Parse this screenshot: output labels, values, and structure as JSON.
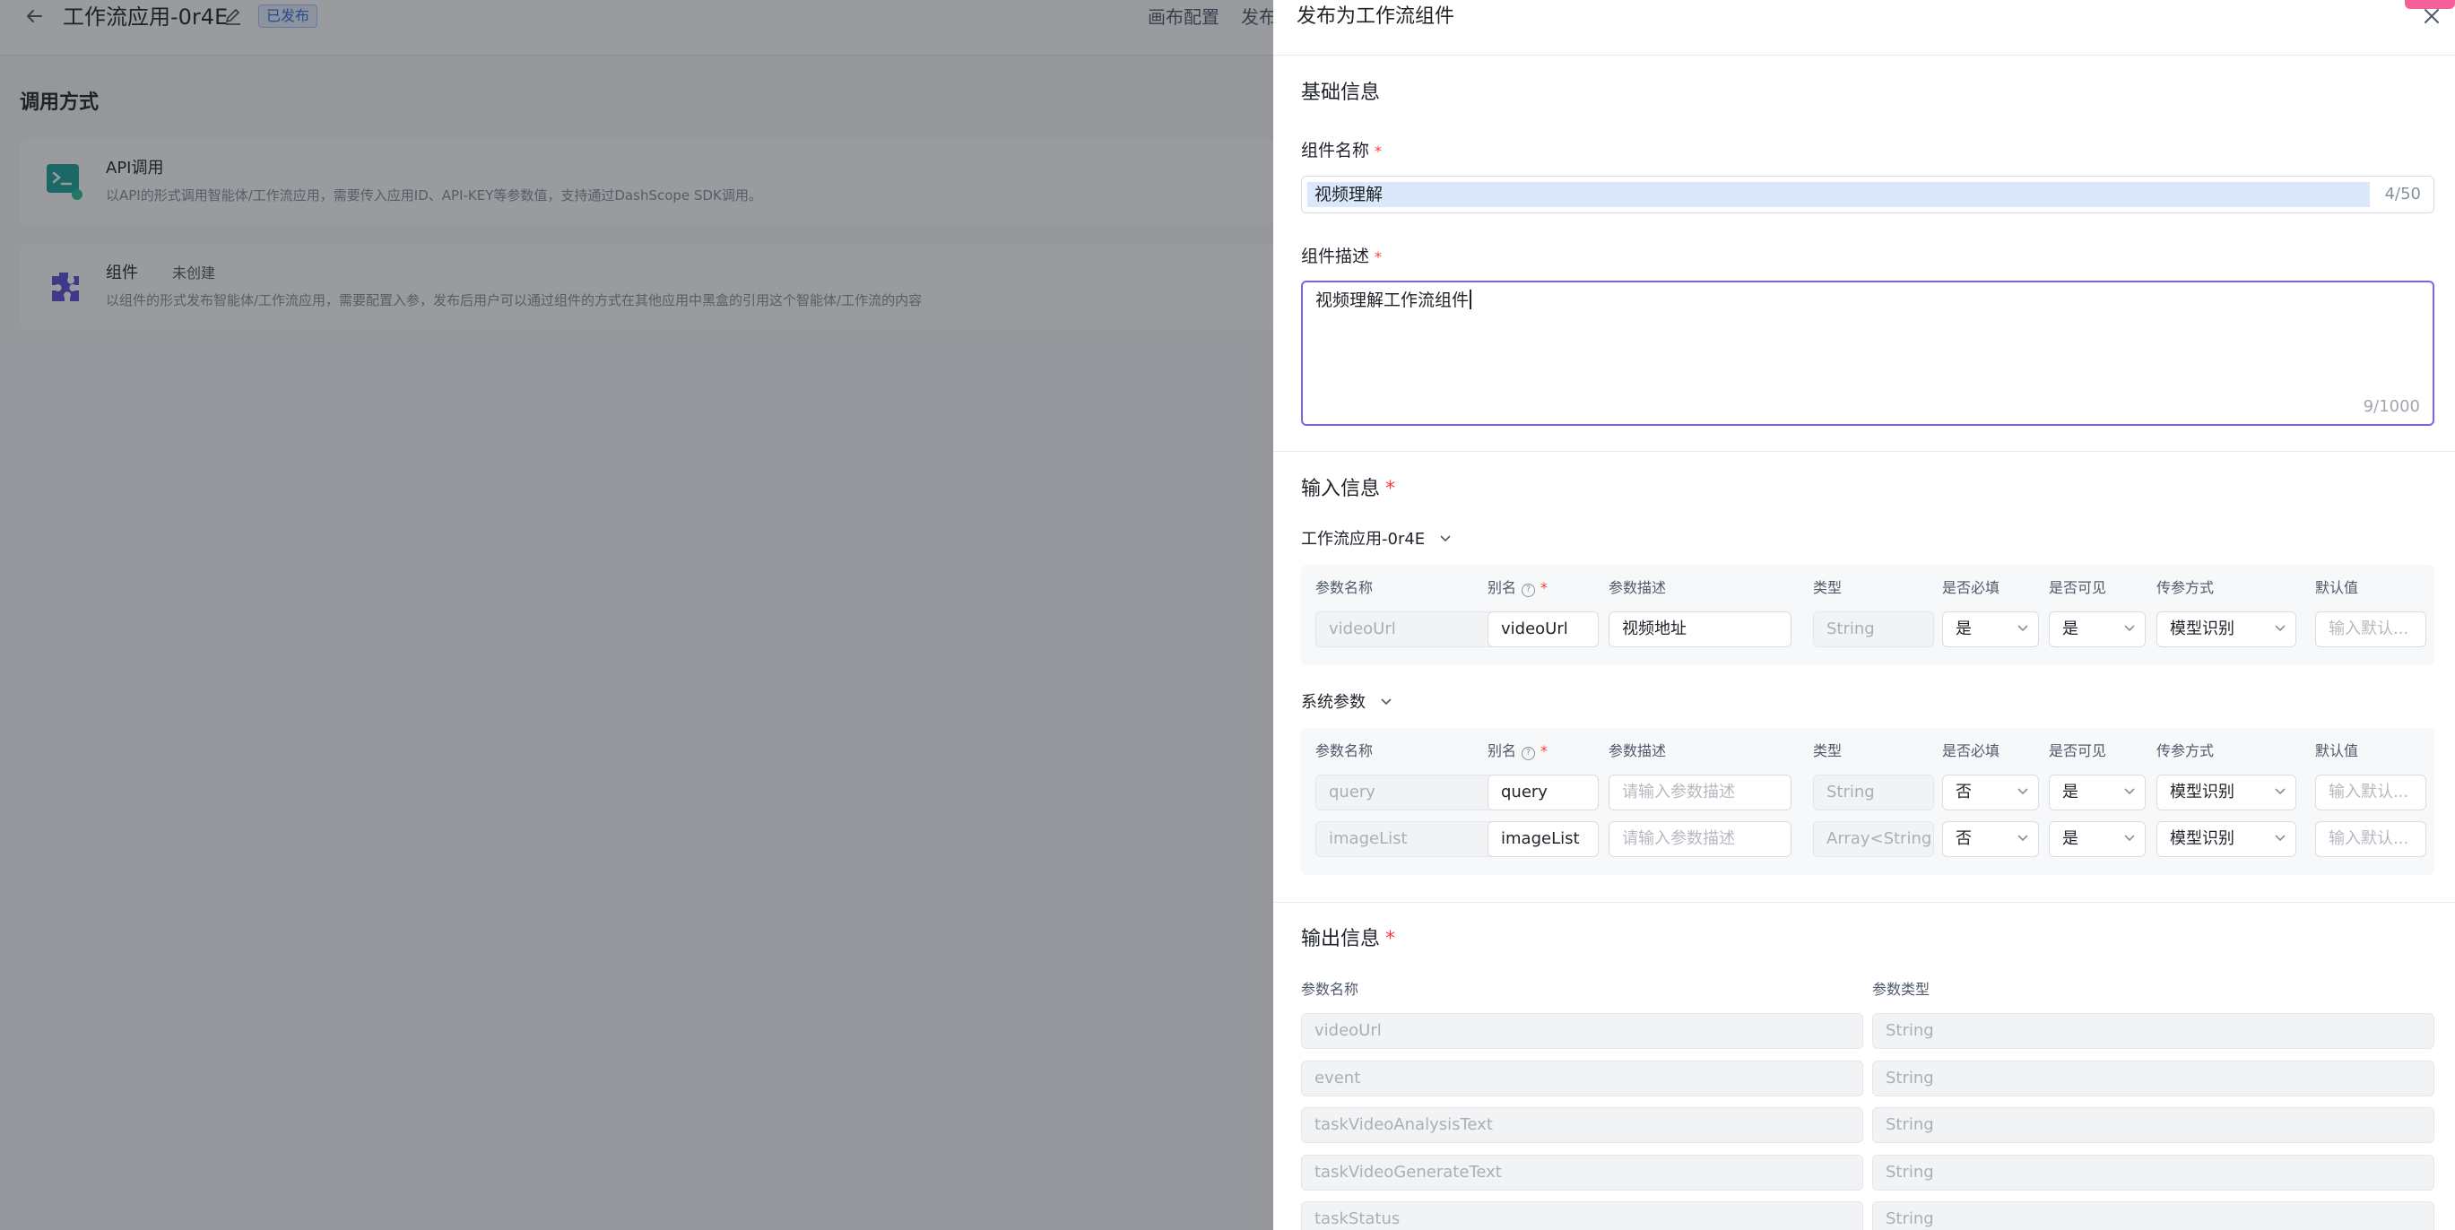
{
  "background": {
    "app_title": "工作流应用-0r4E",
    "status_tag": "已发布",
    "tabs": [
      "画布配置",
      "发布"
    ],
    "section_title": "调用方式",
    "methods": [
      {
        "title": "API调用",
        "subtitle": "",
        "desc": "以API的形式调用智能体/工作流应用，需要传入应用ID、API-KEY等参数值，支持通过DashScope SDK调用。",
        "icon": "terminal-icon"
      },
      {
        "title": "组件",
        "subtitle": "未创建",
        "desc": "以组件的形式发布智能体/工作流应用，需要配置入参，发布后用户可以通过组件的方式在其他应用中黑盒的引用这个智能体/工作流的内容",
        "icon": "puzzle-icon"
      }
    ]
  },
  "drawer": {
    "title": "发布为工作流组件",
    "basic": {
      "title": "基础信息",
      "name_label": "组件名称",
      "name_value": "视频理解",
      "name_count": "4/50",
      "desc_label": "组件描述",
      "desc_value": "视频理解工作流组件",
      "desc_count": "9/1000"
    },
    "input": {
      "title": "输入信息",
      "columns": [
        "参数名称",
        "别名",
        "参数描述",
        "类型",
        "是否必填",
        "是否可见",
        "传参方式",
        "默认值"
      ],
      "app_group": {
        "title": "工作流应用-0r4E",
        "rows": [
          {
            "name": "videoUrl",
            "alias": "videoUrl",
            "desc": "视频地址",
            "desc_is_placeholder": false,
            "type": "String",
            "required": "是",
            "visible": "是",
            "mode": "模型识别",
            "default": "输入默认..."
          }
        ]
      },
      "sys_group": {
        "title": "系统参数",
        "rows": [
          {
            "name": "query",
            "alias": "query",
            "desc": "请输入参数描述",
            "desc_is_placeholder": true,
            "type": "String",
            "required": "否",
            "visible": "是",
            "mode": "模型识别",
            "default": "输入默认..."
          },
          {
            "name": "imageList",
            "alias": "imageList",
            "desc": "请输入参数描述",
            "desc_is_placeholder": true,
            "type": "Array<String>",
            "required": "否",
            "visible": "是",
            "mode": "模型识别",
            "default": "输入默认..."
          }
        ]
      }
    },
    "output": {
      "title": "输出信息",
      "col_name": "参数名称",
      "col_type": "参数类型",
      "rows": [
        {
          "name": "videoUrl",
          "type": "String"
        },
        {
          "name": "event",
          "type": "String"
        },
        {
          "name": "taskVideoAnalysisText",
          "type": "String"
        },
        {
          "name": "taskVideoGenerateText",
          "type": "String"
        },
        {
          "name": "taskStatus",
          "type": "String"
        }
      ]
    }
  },
  "colors": {
    "accent": "#7367f0",
    "required": "#f53f3f",
    "tag_blue": "#2f6fe6"
  }
}
